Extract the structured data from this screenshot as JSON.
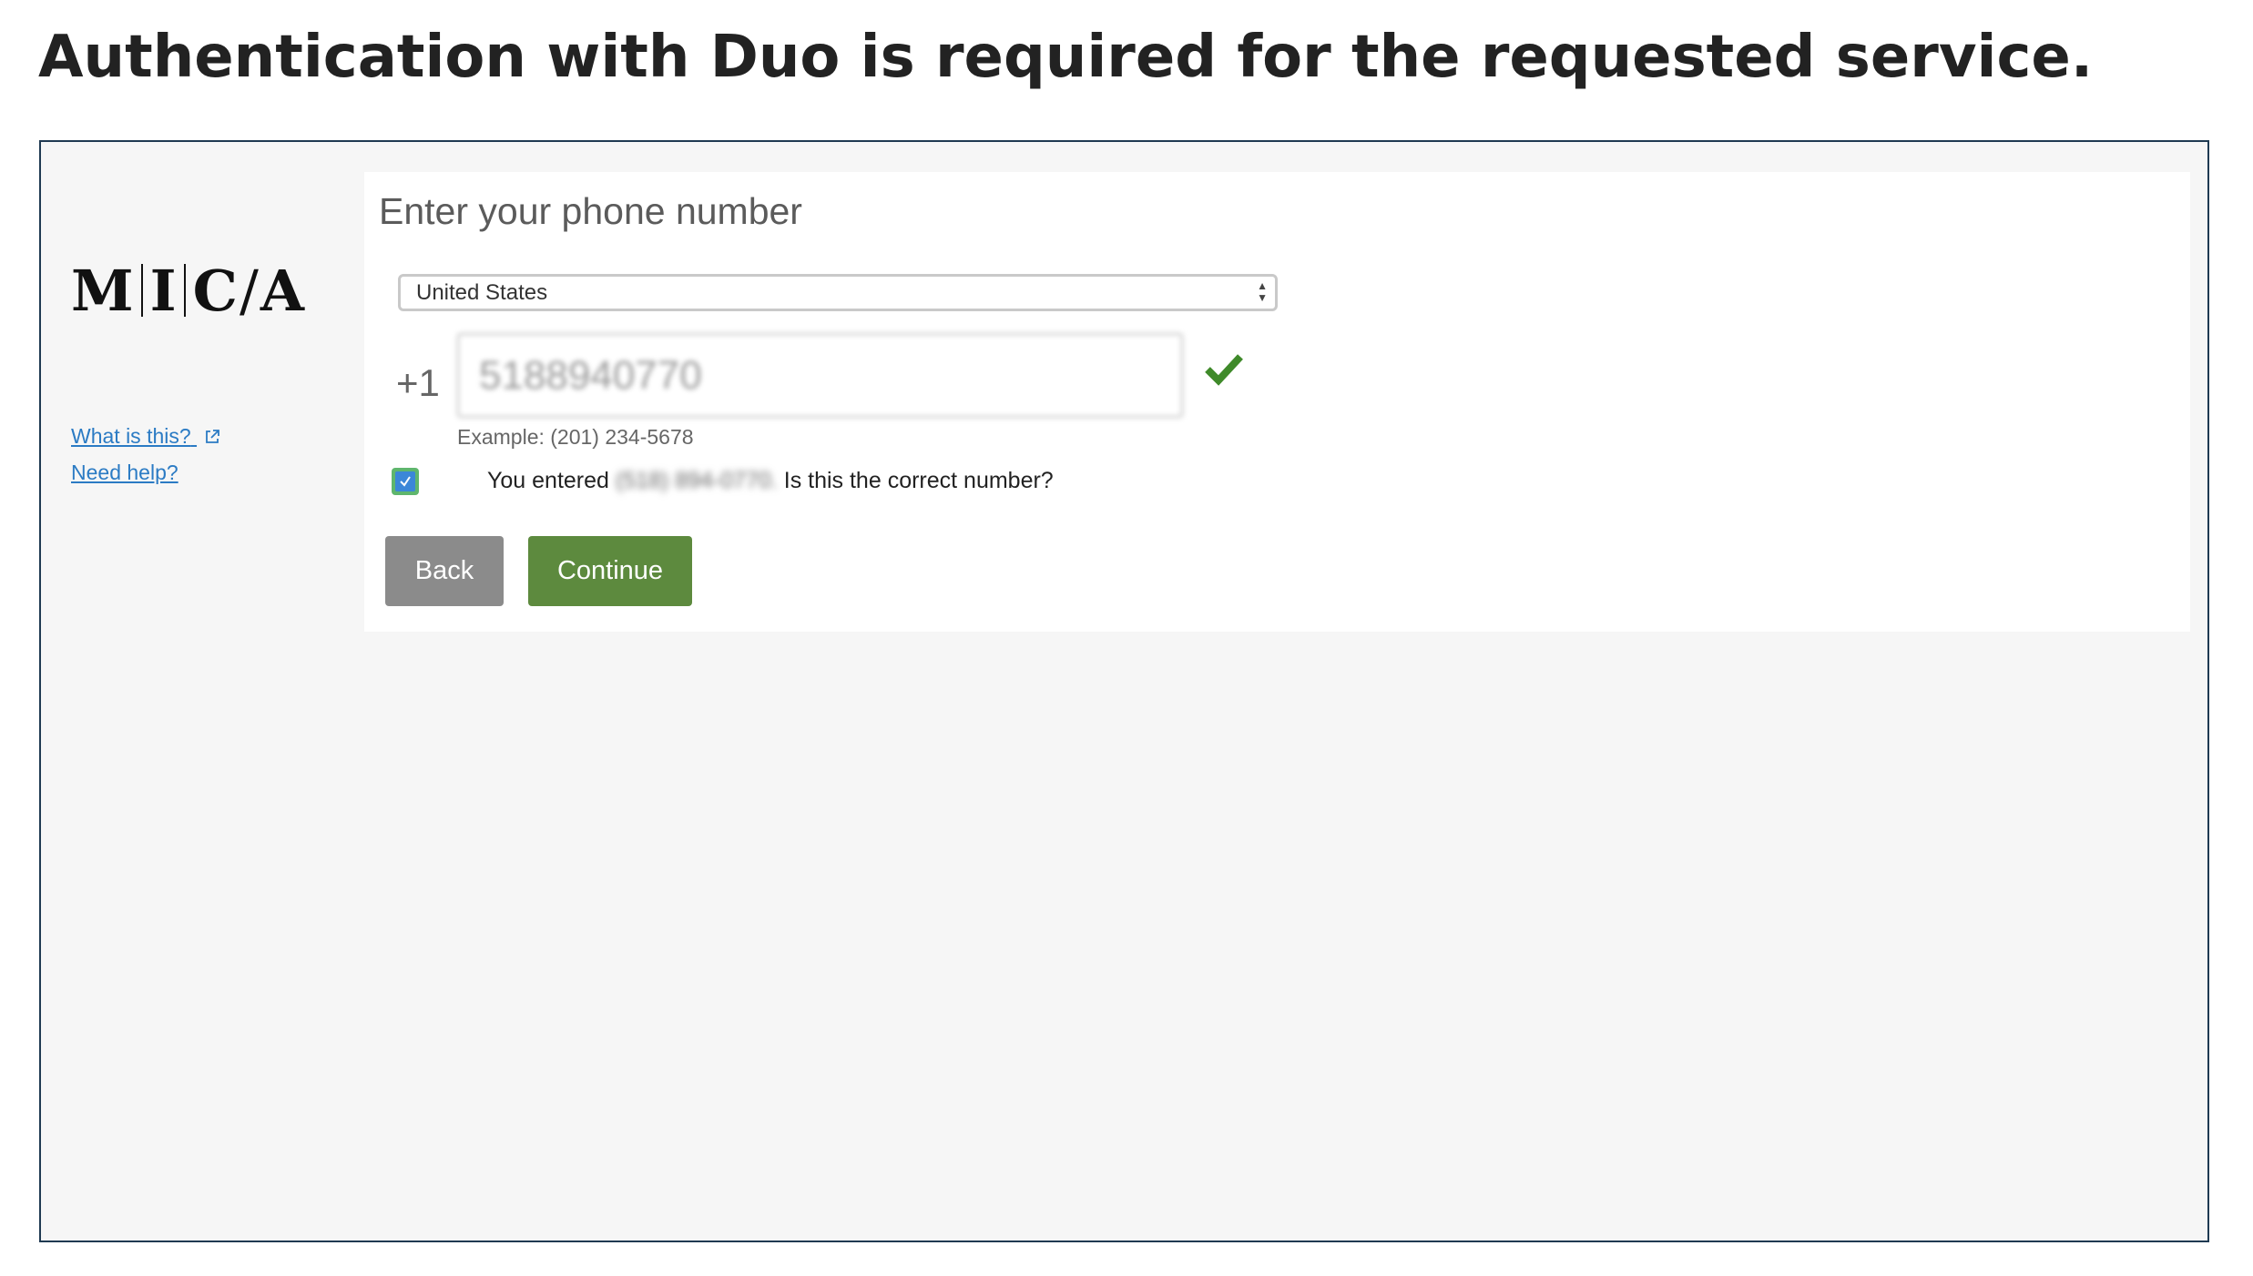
{
  "page": {
    "title": "Authentication with Duo is required for the requested service."
  },
  "sidebar": {
    "logo": {
      "letters": [
        "M",
        "I",
        "C",
        "A"
      ]
    },
    "links": [
      {
        "label": "What is this?",
        "icon": "external-link-icon"
      },
      {
        "label": "Need help?"
      }
    ]
  },
  "form": {
    "title": "Enter your phone number",
    "country": {
      "selected": "United States"
    },
    "phone": {
      "country_code": "+1",
      "value": "5188940770",
      "example": "Example: (201) 234-5678",
      "valid_icon": "check-icon",
      "valid_color": "#3f8a2a"
    },
    "confirm": {
      "checked": true,
      "prefix": "You entered",
      "number": "(518) 894-0770.",
      "suffix": "Is this the correct number?"
    },
    "buttons": {
      "back": "Back",
      "continue": "Continue"
    }
  },
  "colors": {
    "link": "#2b7bc4",
    "continue": "#5d8a3e",
    "back": "#8b8b8b",
    "frame_border": "#1f3a52"
  }
}
